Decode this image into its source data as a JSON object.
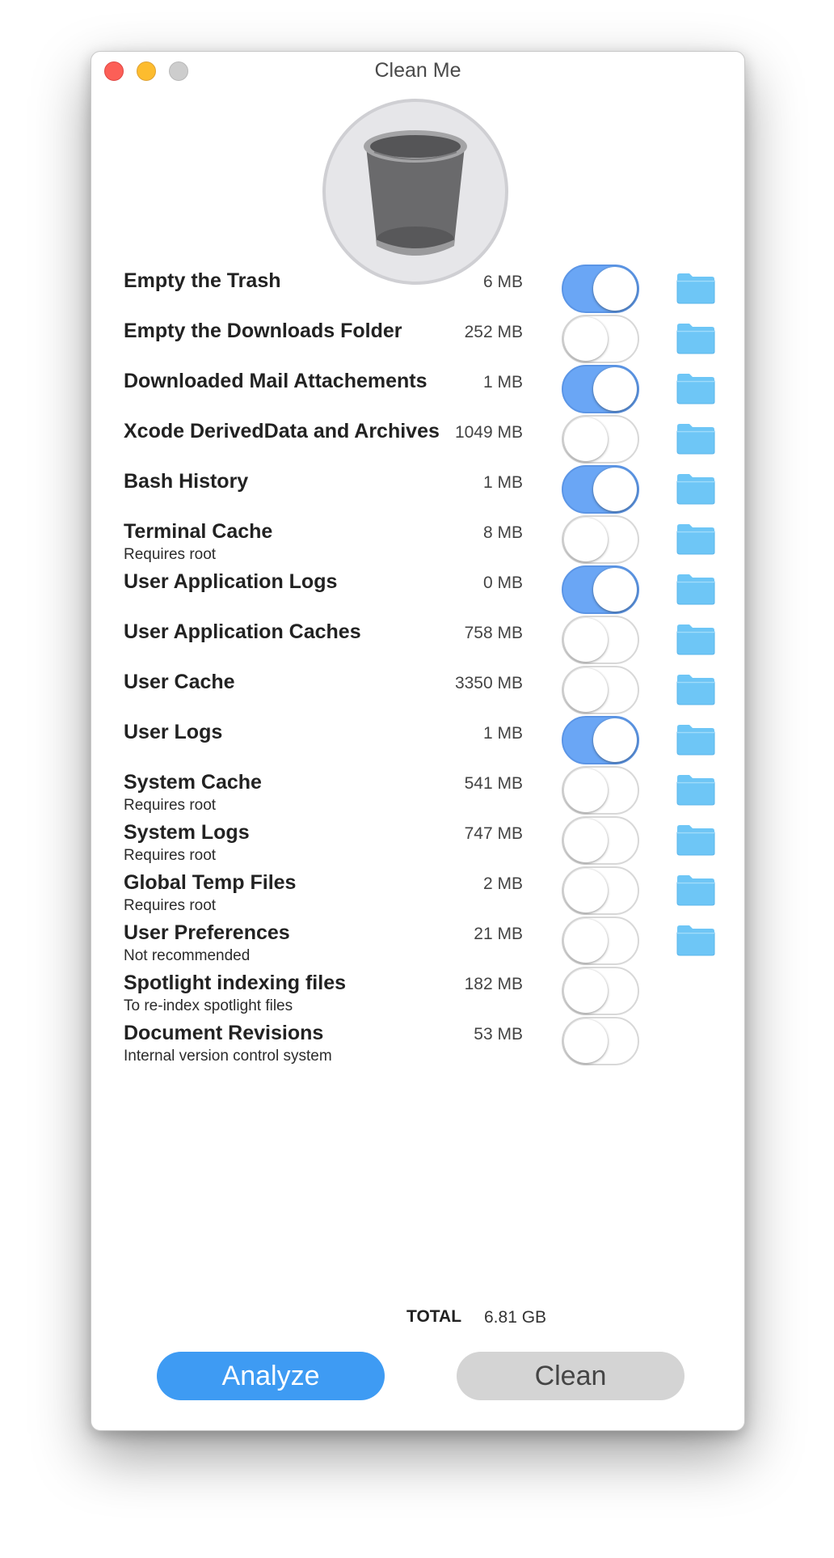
{
  "window": {
    "title": "Clean Me"
  },
  "header": {
    "icon": "trash-icon"
  },
  "items": [
    {
      "label": "Empty the Trash",
      "sub": "",
      "size": "6 MB",
      "enabled": true,
      "folder": true
    },
    {
      "label": "Empty the Downloads Folder",
      "sub": "",
      "size": "252 MB",
      "enabled": false,
      "folder": true
    },
    {
      "label": "Downloaded Mail Attachements",
      "sub": "",
      "size": "1 MB",
      "enabled": true,
      "folder": true
    },
    {
      "label": "Xcode DerivedData and Archives",
      "sub": "",
      "size": "1049 MB",
      "enabled": false,
      "folder": true
    },
    {
      "label": "Bash History",
      "sub": "",
      "size": "1 MB",
      "enabled": true,
      "folder": true
    },
    {
      "label": "Terminal Cache",
      "sub": "Requires root",
      "size": "8 MB",
      "enabled": false,
      "folder": true
    },
    {
      "label": "User Application Logs",
      "sub": "",
      "size": "0 MB",
      "enabled": true,
      "folder": true
    },
    {
      "label": "User Application Caches",
      "sub": "",
      "size": "758 MB",
      "enabled": false,
      "folder": true
    },
    {
      "label": "User Cache",
      "sub": "",
      "size": "3350 MB",
      "enabled": false,
      "folder": true
    },
    {
      "label": "User Logs",
      "sub": "",
      "size": "1 MB",
      "enabled": true,
      "folder": true
    },
    {
      "label": "System Cache",
      "sub": "Requires root",
      "size": "541 MB",
      "enabled": false,
      "folder": true
    },
    {
      "label": "System Logs",
      "sub": "Requires root",
      "size": "747 MB",
      "enabled": false,
      "folder": true
    },
    {
      "label": "Global Temp Files",
      "sub": "Requires root",
      "size": "2 MB",
      "enabled": false,
      "folder": true
    },
    {
      "label": "User Preferences",
      "sub": "Not recommended",
      "size": "21 MB",
      "enabled": false,
      "folder": true
    },
    {
      "label": "Spotlight indexing files",
      "sub": "To re-index spotlight files",
      "size": "182 MB",
      "enabled": false,
      "folder": false
    },
    {
      "label": "Document Revisions",
      "sub": "Internal version control system",
      "size": "53 MB",
      "enabled": false,
      "folder": false
    }
  ],
  "summary": {
    "total_label": "TOTAL",
    "total_value": "6.81 GB"
  },
  "buttons": {
    "analyze": "Analyze",
    "clean": "Clean"
  },
  "colors": {
    "toggle_on": "#6aa6f5",
    "folder": "#6ec6f6",
    "analyze_button": "#3e9bf3",
    "clean_button": "#d4d4d4"
  }
}
